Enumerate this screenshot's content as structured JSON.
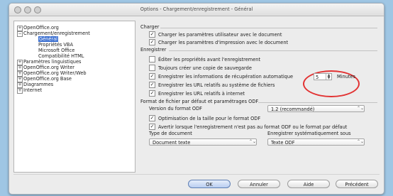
{
  "window": {
    "title": "Options - Chargement/enregistrement - Général"
  },
  "tree": {
    "items": [
      {
        "label": "OpenOffice.org",
        "expander": "+"
      },
      {
        "label": "Chargement/enregistrement",
        "expander": "−"
      },
      {
        "label": "Général"
      },
      {
        "label": "Propriétés VBA"
      },
      {
        "label": "Microsoft Office"
      },
      {
        "label": "Compatibilité HTML"
      },
      {
        "label": "Paramètres linguistiques",
        "expander": "+"
      },
      {
        "label": "OpenOffice.org Writer",
        "expander": "+"
      },
      {
        "label": "OpenOffice.org Writer/Web",
        "expander": "+"
      },
      {
        "label": "OpenOffice.org Base",
        "expander": "+"
      },
      {
        "label": "Diagrammes",
        "expander": "+"
      },
      {
        "label": "Internet",
        "expander": "+"
      }
    ]
  },
  "sections": {
    "charger": "Charger",
    "enregistrer": "Enregistrer",
    "format": "Format de fichier par défaut et paramétrages ODF"
  },
  "charger": {
    "user_settings": "Charger les paramètres utilisateur avec le document",
    "printer_settings": "Charger les paramètres d'impression avec le document"
  },
  "enregistrer": {
    "edit_props": "Éditer les propriétés avant l'enregistrement",
    "backup": "Toujours créer une copie de sauvegarde",
    "autorecovery": "Enregistrer les informations de récupération automatique",
    "autorecovery_value": "5",
    "minutes": "Minutes",
    "url_fs": "Enregistrer les URL relatifs au système de fichiers",
    "url_internet": "Enregistrer les URL relatifs à internet"
  },
  "odf": {
    "version_label": "Version du format ODF",
    "version_value": "1.2 (recommandé)",
    "size_opt": "Optimisation de la taille pour le format ODF",
    "warn": "Avertir lorsque l'enregistrement n'est pas au format ODF ou le format par défaut",
    "doc_type_label": "Type de document",
    "doc_type_value": "Document texte",
    "save_as_label": "Enregistrer systématiquement sous",
    "save_as_value": "Texte ODF"
  },
  "footer": {
    "ok": "OK",
    "cancel": "Annuler",
    "help": "Aide",
    "back": "Précédent"
  },
  "checks": {
    "checked_mark": "✓"
  },
  "colors": {
    "highlight_ring": "#e23232",
    "selection": "#3b6fd0"
  }
}
